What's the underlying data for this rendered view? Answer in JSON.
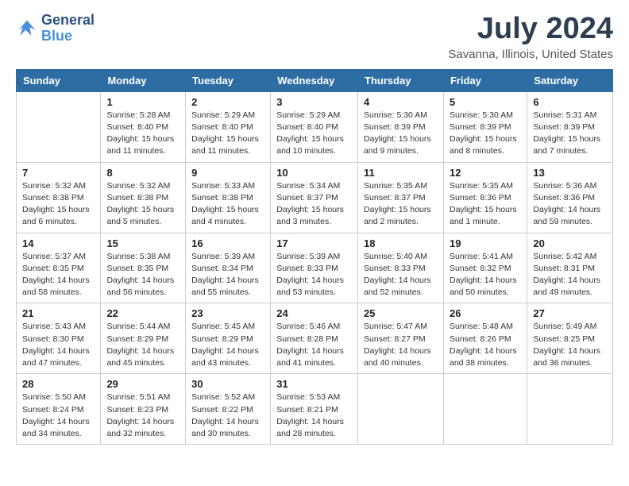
{
  "logo": {
    "line1": "General",
    "line2": "Blue"
  },
  "header": {
    "month": "July 2024",
    "location": "Savanna, Illinois, United States"
  },
  "weekdays": [
    "Sunday",
    "Monday",
    "Tuesday",
    "Wednesday",
    "Thursday",
    "Friday",
    "Saturday"
  ],
  "weeks": [
    [
      {
        "day": "",
        "detail": ""
      },
      {
        "day": "1",
        "detail": "Sunrise: 5:28 AM\nSunset: 8:40 PM\nDaylight: 15 hours\nand 11 minutes."
      },
      {
        "day": "2",
        "detail": "Sunrise: 5:29 AM\nSunset: 8:40 PM\nDaylight: 15 hours\nand 11 minutes."
      },
      {
        "day": "3",
        "detail": "Sunrise: 5:29 AM\nSunset: 8:40 PM\nDaylight: 15 hours\nand 10 minutes."
      },
      {
        "day": "4",
        "detail": "Sunrise: 5:30 AM\nSunset: 8:39 PM\nDaylight: 15 hours\nand 9 minutes."
      },
      {
        "day": "5",
        "detail": "Sunrise: 5:30 AM\nSunset: 8:39 PM\nDaylight: 15 hours\nand 8 minutes."
      },
      {
        "day": "6",
        "detail": "Sunrise: 5:31 AM\nSunset: 8:39 PM\nDaylight: 15 hours\nand 7 minutes."
      }
    ],
    [
      {
        "day": "7",
        "detail": "Sunrise: 5:32 AM\nSunset: 8:38 PM\nDaylight: 15 hours\nand 6 minutes."
      },
      {
        "day": "8",
        "detail": "Sunrise: 5:32 AM\nSunset: 8:38 PM\nDaylight: 15 hours\nand 5 minutes."
      },
      {
        "day": "9",
        "detail": "Sunrise: 5:33 AM\nSunset: 8:38 PM\nDaylight: 15 hours\nand 4 minutes."
      },
      {
        "day": "10",
        "detail": "Sunrise: 5:34 AM\nSunset: 8:37 PM\nDaylight: 15 hours\nand 3 minutes."
      },
      {
        "day": "11",
        "detail": "Sunrise: 5:35 AM\nSunset: 8:37 PM\nDaylight: 15 hours\nand 2 minutes."
      },
      {
        "day": "12",
        "detail": "Sunrise: 5:35 AM\nSunset: 8:36 PM\nDaylight: 15 hours\nand 1 minute."
      },
      {
        "day": "13",
        "detail": "Sunrise: 5:36 AM\nSunset: 8:36 PM\nDaylight: 14 hours\nand 59 minutes."
      }
    ],
    [
      {
        "day": "14",
        "detail": "Sunrise: 5:37 AM\nSunset: 8:35 PM\nDaylight: 14 hours\nand 58 minutes."
      },
      {
        "day": "15",
        "detail": "Sunrise: 5:38 AM\nSunset: 8:35 PM\nDaylight: 14 hours\nand 56 minutes."
      },
      {
        "day": "16",
        "detail": "Sunrise: 5:39 AM\nSunset: 8:34 PM\nDaylight: 14 hours\nand 55 minutes."
      },
      {
        "day": "17",
        "detail": "Sunrise: 5:39 AM\nSunset: 8:33 PM\nDaylight: 14 hours\nand 53 minutes."
      },
      {
        "day": "18",
        "detail": "Sunrise: 5:40 AM\nSunset: 8:33 PM\nDaylight: 14 hours\nand 52 minutes."
      },
      {
        "day": "19",
        "detail": "Sunrise: 5:41 AM\nSunset: 8:32 PM\nDaylight: 14 hours\nand 50 minutes."
      },
      {
        "day": "20",
        "detail": "Sunrise: 5:42 AM\nSunset: 8:31 PM\nDaylight: 14 hours\nand 49 minutes."
      }
    ],
    [
      {
        "day": "21",
        "detail": "Sunrise: 5:43 AM\nSunset: 8:30 PM\nDaylight: 14 hours\nand 47 minutes."
      },
      {
        "day": "22",
        "detail": "Sunrise: 5:44 AM\nSunset: 8:29 PM\nDaylight: 14 hours\nand 45 minutes."
      },
      {
        "day": "23",
        "detail": "Sunrise: 5:45 AM\nSunset: 8:29 PM\nDaylight: 14 hours\nand 43 minutes."
      },
      {
        "day": "24",
        "detail": "Sunrise: 5:46 AM\nSunset: 8:28 PM\nDaylight: 14 hours\nand 41 minutes."
      },
      {
        "day": "25",
        "detail": "Sunrise: 5:47 AM\nSunset: 8:27 PM\nDaylight: 14 hours\nand 40 minutes."
      },
      {
        "day": "26",
        "detail": "Sunrise: 5:48 AM\nSunset: 8:26 PM\nDaylight: 14 hours\nand 38 minutes."
      },
      {
        "day": "27",
        "detail": "Sunrise: 5:49 AM\nSunset: 8:25 PM\nDaylight: 14 hours\nand 36 minutes."
      }
    ],
    [
      {
        "day": "28",
        "detail": "Sunrise: 5:50 AM\nSunset: 8:24 PM\nDaylight: 14 hours\nand 34 minutes."
      },
      {
        "day": "29",
        "detail": "Sunrise: 5:51 AM\nSunset: 8:23 PM\nDaylight: 14 hours\nand 32 minutes."
      },
      {
        "day": "30",
        "detail": "Sunrise: 5:52 AM\nSunset: 8:22 PM\nDaylight: 14 hours\nand 30 minutes."
      },
      {
        "day": "31",
        "detail": "Sunrise: 5:53 AM\nSunset: 8:21 PM\nDaylight: 14 hours\nand 28 minutes."
      },
      {
        "day": "",
        "detail": ""
      },
      {
        "day": "",
        "detail": ""
      },
      {
        "day": "",
        "detail": ""
      }
    ]
  ]
}
